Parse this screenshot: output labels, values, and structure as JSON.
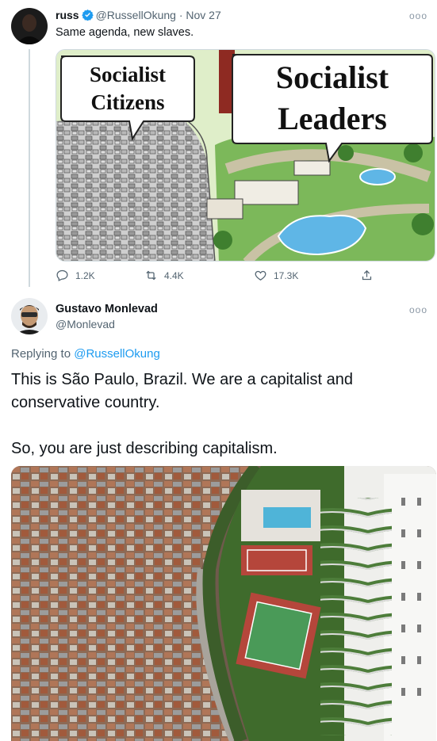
{
  "tweet1": {
    "name": "russ",
    "handle": "@RussellOkung",
    "date": "· Nov 27",
    "text": "Same agenda, new slaves.",
    "image": {
      "left_bubble": [
        "Socialist",
        "Citizens"
      ],
      "right_bubble": [
        "Socialist",
        "Leaders"
      ]
    },
    "actions": {
      "replies": "1.2K",
      "retweets": "4.4K",
      "likes": "17.3K"
    },
    "more": "ooo"
  },
  "tweet2": {
    "name": "Gustavo Monlevad",
    "handle": "@Monlevad",
    "replying_prefix": "Replying to",
    "replying_to": "@RussellOkung",
    "paragraph1": "This is São Paulo, Brazil. We are a capitalist and conservative country.",
    "paragraph2": "So, you are just describing capitalism.",
    "more": "ooo"
  },
  "colors": {
    "link": "#1d9bf0",
    "muted": "#536471",
    "verified": "#1d9bf0"
  }
}
